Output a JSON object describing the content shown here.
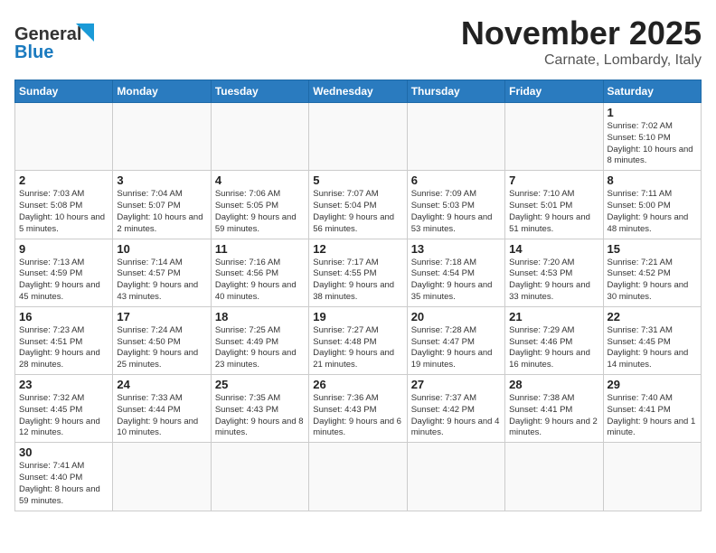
{
  "header": {
    "logo_general": "General",
    "logo_blue": "Blue",
    "month": "November 2025",
    "location": "Carnate, Lombardy, Italy"
  },
  "weekdays": [
    "Sunday",
    "Monday",
    "Tuesday",
    "Wednesday",
    "Thursday",
    "Friday",
    "Saturday"
  ],
  "weeks": [
    [
      {
        "day": "",
        "info": ""
      },
      {
        "day": "",
        "info": ""
      },
      {
        "day": "",
        "info": ""
      },
      {
        "day": "",
        "info": ""
      },
      {
        "day": "",
        "info": ""
      },
      {
        "day": "",
        "info": ""
      },
      {
        "day": "1",
        "info": "Sunrise: 7:02 AM\nSunset: 5:10 PM\nDaylight: 10 hours and 8 minutes."
      }
    ],
    [
      {
        "day": "2",
        "info": "Sunrise: 7:03 AM\nSunset: 5:08 PM\nDaylight: 10 hours and 5 minutes."
      },
      {
        "day": "3",
        "info": "Sunrise: 7:04 AM\nSunset: 5:07 PM\nDaylight: 10 hours and 2 minutes."
      },
      {
        "day": "4",
        "info": "Sunrise: 7:06 AM\nSunset: 5:05 PM\nDaylight: 9 hours and 59 minutes."
      },
      {
        "day": "5",
        "info": "Sunrise: 7:07 AM\nSunset: 5:04 PM\nDaylight: 9 hours and 56 minutes."
      },
      {
        "day": "6",
        "info": "Sunrise: 7:09 AM\nSunset: 5:03 PM\nDaylight: 9 hours and 53 minutes."
      },
      {
        "day": "7",
        "info": "Sunrise: 7:10 AM\nSunset: 5:01 PM\nDaylight: 9 hours and 51 minutes."
      },
      {
        "day": "8",
        "info": "Sunrise: 7:11 AM\nSunset: 5:00 PM\nDaylight: 9 hours and 48 minutes."
      }
    ],
    [
      {
        "day": "9",
        "info": "Sunrise: 7:13 AM\nSunset: 4:59 PM\nDaylight: 9 hours and 45 minutes."
      },
      {
        "day": "10",
        "info": "Sunrise: 7:14 AM\nSunset: 4:57 PM\nDaylight: 9 hours and 43 minutes."
      },
      {
        "day": "11",
        "info": "Sunrise: 7:16 AM\nSunset: 4:56 PM\nDaylight: 9 hours and 40 minutes."
      },
      {
        "day": "12",
        "info": "Sunrise: 7:17 AM\nSunset: 4:55 PM\nDaylight: 9 hours and 38 minutes."
      },
      {
        "day": "13",
        "info": "Sunrise: 7:18 AM\nSunset: 4:54 PM\nDaylight: 9 hours and 35 minutes."
      },
      {
        "day": "14",
        "info": "Sunrise: 7:20 AM\nSunset: 4:53 PM\nDaylight: 9 hours and 33 minutes."
      },
      {
        "day": "15",
        "info": "Sunrise: 7:21 AM\nSunset: 4:52 PM\nDaylight: 9 hours and 30 minutes."
      }
    ],
    [
      {
        "day": "16",
        "info": "Sunrise: 7:23 AM\nSunset: 4:51 PM\nDaylight: 9 hours and 28 minutes."
      },
      {
        "day": "17",
        "info": "Sunrise: 7:24 AM\nSunset: 4:50 PM\nDaylight: 9 hours and 25 minutes."
      },
      {
        "day": "18",
        "info": "Sunrise: 7:25 AM\nSunset: 4:49 PM\nDaylight: 9 hours and 23 minutes."
      },
      {
        "day": "19",
        "info": "Sunrise: 7:27 AM\nSunset: 4:48 PM\nDaylight: 9 hours and 21 minutes."
      },
      {
        "day": "20",
        "info": "Sunrise: 7:28 AM\nSunset: 4:47 PM\nDaylight: 9 hours and 19 minutes."
      },
      {
        "day": "21",
        "info": "Sunrise: 7:29 AM\nSunset: 4:46 PM\nDaylight: 9 hours and 16 minutes."
      },
      {
        "day": "22",
        "info": "Sunrise: 7:31 AM\nSunset: 4:45 PM\nDaylight: 9 hours and 14 minutes."
      }
    ],
    [
      {
        "day": "23",
        "info": "Sunrise: 7:32 AM\nSunset: 4:45 PM\nDaylight: 9 hours and 12 minutes."
      },
      {
        "day": "24",
        "info": "Sunrise: 7:33 AM\nSunset: 4:44 PM\nDaylight: 9 hours and 10 minutes."
      },
      {
        "day": "25",
        "info": "Sunrise: 7:35 AM\nSunset: 4:43 PM\nDaylight: 9 hours and 8 minutes."
      },
      {
        "day": "26",
        "info": "Sunrise: 7:36 AM\nSunset: 4:43 PM\nDaylight: 9 hours and 6 minutes."
      },
      {
        "day": "27",
        "info": "Sunrise: 7:37 AM\nSunset: 4:42 PM\nDaylight: 9 hours and 4 minutes."
      },
      {
        "day": "28",
        "info": "Sunrise: 7:38 AM\nSunset: 4:41 PM\nDaylight: 9 hours and 2 minutes."
      },
      {
        "day": "29",
        "info": "Sunrise: 7:40 AM\nSunset: 4:41 PM\nDaylight: 9 hours and 1 minute."
      }
    ],
    [
      {
        "day": "30",
        "info": "Sunrise: 7:41 AM\nSunset: 4:40 PM\nDaylight: 8 hours and 59 minutes."
      },
      {
        "day": "",
        "info": ""
      },
      {
        "day": "",
        "info": ""
      },
      {
        "day": "",
        "info": ""
      },
      {
        "day": "",
        "info": ""
      },
      {
        "day": "",
        "info": ""
      },
      {
        "day": "",
        "info": ""
      }
    ]
  ]
}
